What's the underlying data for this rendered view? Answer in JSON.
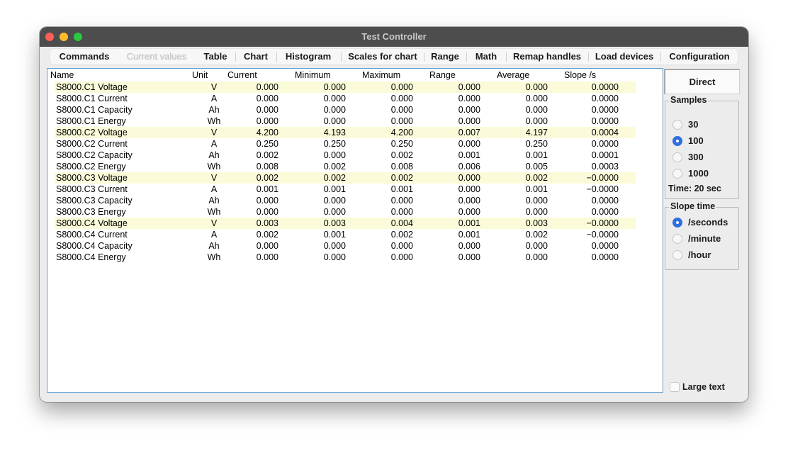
{
  "window": {
    "title": "Test Controller"
  },
  "tabs": [
    {
      "label": "Commands"
    },
    {
      "label": "Current values"
    },
    {
      "label": "Table"
    },
    {
      "label": "Chart"
    },
    {
      "label": "Histogram"
    },
    {
      "label": "Scales for chart"
    },
    {
      "label": "Range"
    },
    {
      "label": "Math"
    },
    {
      "label": "Remap handles"
    },
    {
      "label": "Load devices"
    },
    {
      "label": "Configuration"
    }
  ],
  "table": {
    "headers": {
      "name": "Name",
      "unit": "Unit",
      "current": "Current",
      "minimum": "Minimum",
      "maximum": "Maximum",
      "range": "Range",
      "average": "Average",
      "slope": "Slope /s"
    },
    "rows": [
      {
        "name": "S8000.C1 Voltage",
        "unit": "V",
        "current": "0.000",
        "minimum": "0.000",
        "maximum": "0.000",
        "range": "0.000",
        "average": "0.000",
        "slope": "0.0000"
      },
      {
        "name": "S8000.C1 Current",
        "unit": "A",
        "current": "0.000",
        "minimum": "0.000",
        "maximum": "0.000",
        "range": "0.000",
        "average": "0.000",
        "slope": "0.0000"
      },
      {
        "name": "S8000.C1 Capacity",
        "unit": "Ah",
        "current": "0.000",
        "minimum": "0.000",
        "maximum": "0.000",
        "range": "0.000",
        "average": "0.000",
        "slope": "0.0000"
      },
      {
        "name": "S8000.C1 Energy",
        "unit": "Wh",
        "current": "0.000",
        "minimum": "0.000",
        "maximum": "0.000",
        "range": "0.000",
        "average": "0.000",
        "slope": "0.0000"
      },
      {
        "name": "S8000.C2 Voltage",
        "unit": "V",
        "current": "4.200",
        "minimum": "4.193",
        "maximum": "4.200",
        "range": "0.007",
        "average": "4.197",
        "slope": "0.0004"
      },
      {
        "name": "S8000.C2 Current",
        "unit": "A",
        "current": "0.250",
        "minimum": "0.250",
        "maximum": "0.250",
        "range": "0.000",
        "average": "0.250",
        "slope": "0.0000"
      },
      {
        "name": "S8000.C2 Capacity",
        "unit": "Ah",
        "current": "0.002",
        "minimum": "0.000",
        "maximum": "0.002",
        "range": "0.001",
        "average": "0.001",
        "slope": "0.0001"
      },
      {
        "name": "S8000.C2 Energy",
        "unit": "Wh",
        "current": "0.008",
        "minimum": "0.002",
        "maximum": "0.008",
        "range": "0.006",
        "average": "0.005",
        "slope": "0.0003"
      },
      {
        "name": "S8000.C3 Voltage",
        "unit": "V",
        "current": "0.002",
        "minimum": "0.002",
        "maximum": "0.002",
        "range": "0.000",
        "average": "0.002",
        "slope": "−0.0000"
      },
      {
        "name": "S8000.C3 Current",
        "unit": "A",
        "current": "0.001",
        "minimum": "0.001",
        "maximum": "0.001",
        "range": "0.000",
        "average": "0.001",
        "slope": "−0.0000"
      },
      {
        "name": "S8000.C3 Capacity",
        "unit": "Ah",
        "current": "0.000",
        "minimum": "0.000",
        "maximum": "0.000",
        "range": "0.000",
        "average": "0.000",
        "slope": "0.0000"
      },
      {
        "name": "S8000.C3 Energy",
        "unit": "Wh",
        "current": "0.000",
        "minimum": "0.000",
        "maximum": "0.000",
        "range": "0.000",
        "average": "0.000",
        "slope": "0.0000"
      },
      {
        "name": "S8000.C4 Voltage",
        "unit": "V",
        "current": "0.003",
        "minimum": "0.003",
        "maximum": "0.004",
        "range": "0.001",
        "average": "0.003",
        "slope": "−0.0000"
      },
      {
        "name": "S8000.C4 Current",
        "unit": "A",
        "current": "0.002",
        "minimum": "0.001",
        "maximum": "0.002",
        "range": "0.001",
        "average": "0.002",
        "slope": "−0.0000"
      },
      {
        "name": "S8000.C4 Capacity",
        "unit": "Ah",
        "current": "0.000",
        "minimum": "0.000",
        "maximum": "0.000",
        "range": "0.000",
        "average": "0.000",
        "slope": "0.0000"
      },
      {
        "name": "S8000.C4 Energy",
        "unit": "Wh",
        "current": "0.000",
        "minimum": "0.000",
        "maximum": "0.000",
        "range": "0.000",
        "average": "0.000",
        "slope": "0.0000"
      }
    ]
  },
  "side": {
    "direct_label": "Direct",
    "samples": {
      "label": "Samples",
      "options": [
        "30",
        "100",
        "300",
        "1000"
      ],
      "selected": "100",
      "time_label": "Time: 20 sec"
    },
    "slope_time": {
      "label": "Slope time",
      "options": [
        "/seconds",
        "/minute",
        "/hour"
      ],
      "selected": "/seconds"
    },
    "large_text_label": "Large text"
  }
}
